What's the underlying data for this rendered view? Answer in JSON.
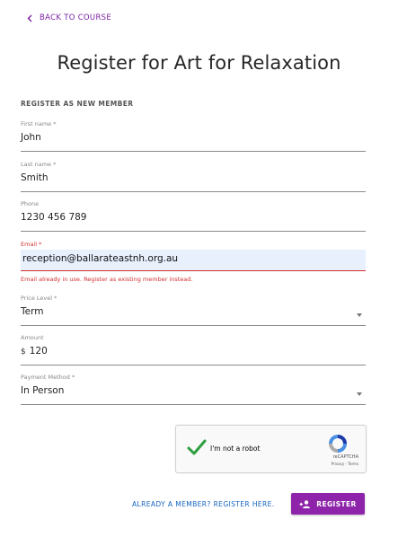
{
  "nav": {
    "back_label": "BACK TO COURSE"
  },
  "page": {
    "title": "Register for Art for Relaxation"
  },
  "form": {
    "section_heading": "REGISTER AS NEW MEMBER",
    "first_name": {
      "label": "First name *",
      "value": "John"
    },
    "last_name": {
      "label": "Last name *",
      "value": "Smith"
    },
    "phone": {
      "label": "Phone",
      "value": "1230 456 789"
    },
    "email": {
      "label": "Email *",
      "value": "reception@ballarateastnh.org.au",
      "error": "Email already in use. Register as existing member instead."
    },
    "price_level": {
      "label": "Price Level *",
      "value": "Term"
    },
    "amount": {
      "label": "Amount",
      "prefix": "$",
      "value": "120"
    },
    "payment_method": {
      "label": "Payment Method *",
      "value": "In Person"
    }
  },
  "recaptcha": {
    "label": "I'm not a robot",
    "brand": "reCAPTCHA",
    "links": "Privacy - Terms",
    "checked": true
  },
  "actions": {
    "already_member_label": "ALREADY A MEMBER? REGISTER HERE.",
    "register_label": "REGISTER"
  },
  "colors": {
    "accent": "#8e24aa",
    "link": "#1565c0",
    "error": "#d32f2f",
    "autofill": "#e8f0fe"
  }
}
